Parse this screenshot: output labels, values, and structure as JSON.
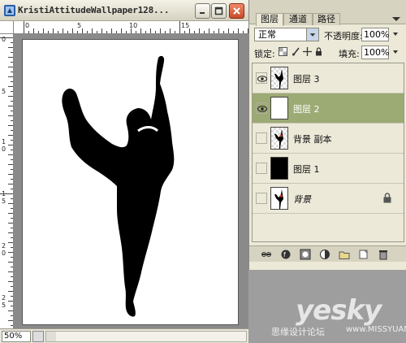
{
  "document": {
    "title": "KristiAttitudeWallpaper128...",
    "zoom": "50%",
    "ruler_top_numbers": [
      "0",
      "5",
      "10",
      "15"
    ],
    "ruler_left_numbers": [
      "0",
      "5",
      "1\n0",
      "1\n5",
      "2\n0",
      "2\n5"
    ]
  },
  "layers_panel": {
    "tabs": [
      "图层",
      "通道",
      "路径"
    ],
    "active_tab": "图层",
    "blend_mode": "正常",
    "opacity_label": "不透明度:",
    "opacity_value": "100%",
    "lock_label": "锁定:",
    "fill_label": "填充:",
    "fill_value": "100%",
    "layers": [
      {
        "name": "图层 3",
        "visible": true,
        "selected": false,
        "thumb": "dancer-transparent"
      },
      {
        "name": "图层 2",
        "visible": true,
        "selected": true,
        "thumb": "white"
      },
      {
        "name": "背景 副本",
        "visible": false,
        "selected": false,
        "thumb": "dancer-transparent"
      },
      {
        "name": "图层 1",
        "visible": false,
        "selected": false,
        "thumb": "black"
      },
      {
        "name": "背景",
        "visible": false,
        "selected": false,
        "thumb": "dancer-white",
        "locked": true
      }
    ]
  },
  "watermark": {
    "logo": "yesky",
    "text": "思缘设计论坛",
    "url": "www.MISSYUAN.COM"
  },
  "colors": {
    "selected_row": "#9caa74",
    "panel_bg": "#ece9d8",
    "close_button": "#d0502e"
  }
}
